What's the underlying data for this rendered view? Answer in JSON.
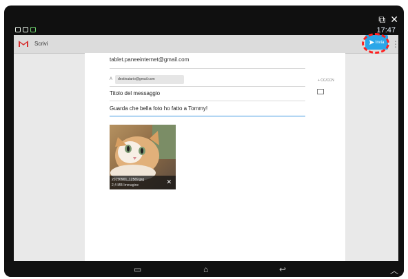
{
  "status": {
    "time": "17:47"
  },
  "app": {
    "title": "Scrivi",
    "send_label": "Invia"
  },
  "compose": {
    "from": "tablet.paneeinternet@gmail.com",
    "to_label": "A",
    "to_chip": "destinatario@gmail.com",
    "cc_label": "+ CC/CCN",
    "subject": "Titolo del messaggio",
    "body": "Guarda che bella foto ho fatto a Tommy!"
  },
  "attachment": {
    "filename": "20150901_12569.jpg",
    "size": "2,4 MB Immagine"
  },
  "icons": {
    "gmail": "gmail-icon",
    "send": "send-icon",
    "overflow": "overflow-menu-icon",
    "attach": "attach-icon",
    "close": "close-icon",
    "back": "back-icon",
    "home": "home-icon",
    "recents": "recents-icon",
    "up": "chevron-up-icon"
  }
}
